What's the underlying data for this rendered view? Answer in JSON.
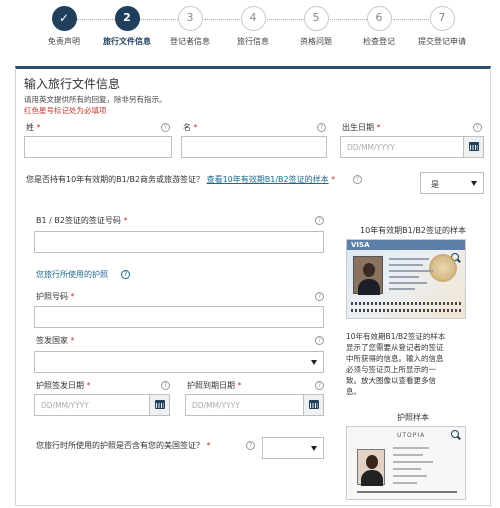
{
  "stepper": {
    "steps": [
      {
        "num": "✓",
        "label": "免责声明",
        "state": "done"
      },
      {
        "num": "2",
        "label": "旅行文件信息",
        "state": "active"
      },
      {
        "num": "3",
        "label": "登记者信息",
        "state": "pending"
      },
      {
        "num": "4",
        "label": "旅行信息",
        "state": "pending"
      },
      {
        "num": "5",
        "label": "资格问题",
        "state": "pending"
      },
      {
        "num": "6",
        "label": "检查登记",
        "state": "pending"
      },
      {
        "num": "7",
        "label": "提交登记申请",
        "state": "pending"
      }
    ]
  },
  "form": {
    "title": "输入旅行文件信息",
    "instructions": "请用英文提供所有的回复，除非另有指示。",
    "required_note": "红色星号标记处为必填项",
    "surname_label": "姓",
    "given_name_label": "名",
    "dob_label": "出生日期",
    "dob_placeholder": "DD/MM/YYYY",
    "visa_question": "您是否持有10年有效期的B1/B2商务或旅游签证？",
    "visa_question_link": "查看10年有效期B1/B2签证的样本",
    "visa_answer": "是",
    "visa_number_label": "B1 / B2签证的签证号码",
    "passport_section_link": "您旅行所使用的护照",
    "passport_number_label": "护照号码",
    "issuing_country_label": "签发国家",
    "issue_date_label": "护照签发日期",
    "issue_date_placeholder": "DD/MM/YYYY",
    "expiry_date_label": "护照到期日期",
    "expiry_date_placeholder": "DD/MM/YYYY",
    "us_visa_question": "您旅行时所使用的护照是否含有您的美国签证？",
    "star": "*",
    "help": "?"
  },
  "samples": {
    "visa_title": "10年有效期B1/B2签证的样本",
    "visa_badge": "VISA",
    "visa_desc_lines": [
      "10年有效期B1/B2签证的样本",
      "显示了您需要从登记者的签证",
      "中所获得的信息。输入的信息",
      "必须与签证页上所显示的一",
      "致。放大图像以查看更多信",
      "息。"
    ],
    "passport_title": "护照样本",
    "passport_header": "UTOPIA"
  },
  "colors": {
    "accent": "#1f3f5d",
    "required": "#c0392b",
    "link": "#1b6a8c"
  }
}
